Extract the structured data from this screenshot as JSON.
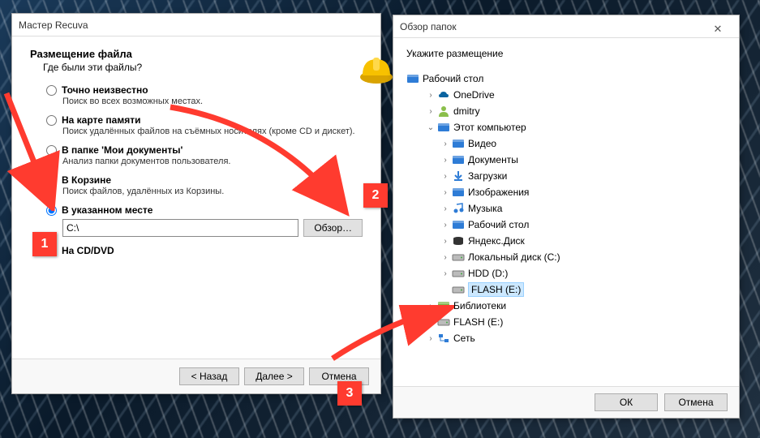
{
  "wizard": {
    "title": "Мастер Recuva",
    "heading": "Размещение файла",
    "subheading": "Где были эти файлы?",
    "options": [
      {
        "label": "Точно неизвестно",
        "desc": "Поиск во всех возможных местах."
      },
      {
        "label": "На карте памяти",
        "desc": "Поиск удалённых файлов на съёмных носителях (кроме CD и дискет)."
      },
      {
        "label": "В папке 'Мои документы'",
        "desc": "Анализ папки документов пользователя."
      },
      {
        "label": "В Корзине",
        "desc": "Поиск файлов, удалённых из Корзины."
      },
      {
        "label": "В указанном месте",
        "desc": ""
      },
      {
        "label": "На CD/DVD",
        "desc": ""
      }
    ],
    "selected_index": 4,
    "path_value": "C:\\",
    "browse_btn": "Обзор…",
    "back_btn": "< Назад",
    "next_btn": "Далее >",
    "cancel_btn": "Отмена"
  },
  "browse": {
    "title": "Обзор папок",
    "prompt": "Укажите размещение",
    "tree": {
      "root": "Рабочий стол",
      "items": [
        {
          "indent": 1,
          "exp": ">",
          "icon": "onedrive",
          "label": "OneDrive"
        },
        {
          "indent": 1,
          "exp": ">",
          "icon": "user",
          "label": "dmitry"
        },
        {
          "indent": 1,
          "exp": "v",
          "icon": "pc",
          "label": "Этот компьютер"
        },
        {
          "indent": 2,
          "exp": ">",
          "icon": "video",
          "label": "Видео"
        },
        {
          "indent": 2,
          "exp": ">",
          "icon": "docs",
          "label": "Документы"
        },
        {
          "indent": 2,
          "exp": ">",
          "icon": "down",
          "label": "Загрузки"
        },
        {
          "indent": 2,
          "exp": ">",
          "icon": "pics",
          "label": "Изображения"
        },
        {
          "indent": 2,
          "exp": ">",
          "icon": "music",
          "label": "Музыка"
        },
        {
          "indent": 2,
          "exp": ">",
          "icon": "desk",
          "label": "Рабочий стол"
        },
        {
          "indent": 2,
          "exp": ">",
          "icon": "ydisk",
          "label": "Яндекс.Диск"
        },
        {
          "indent": 2,
          "exp": ">",
          "icon": "drive",
          "label": "Локальный диск (C:)"
        },
        {
          "indent": 2,
          "exp": ">",
          "icon": "drive",
          "label": "HDD (D:)"
        },
        {
          "indent": 2,
          "exp": "",
          "icon": "drive",
          "label": "FLASH (E:)",
          "selected": true
        },
        {
          "indent": 1,
          "exp": ">",
          "icon": "libs",
          "label": "Библиотеки"
        },
        {
          "indent": 1,
          "exp": ">",
          "icon": "drive",
          "label": "FLASH (E:)"
        },
        {
          "indent": 1,
          "exp": ">",
          "icon": "net",
          "label": "Сеть"
        }
      ]
    },
    "ok_btn": "ОК",
    "cancel_btn": "Отмена"
  },
  "annotations": {
    "n1": "1",
    "n2": "2",
    "n3": "3"
  }
}
